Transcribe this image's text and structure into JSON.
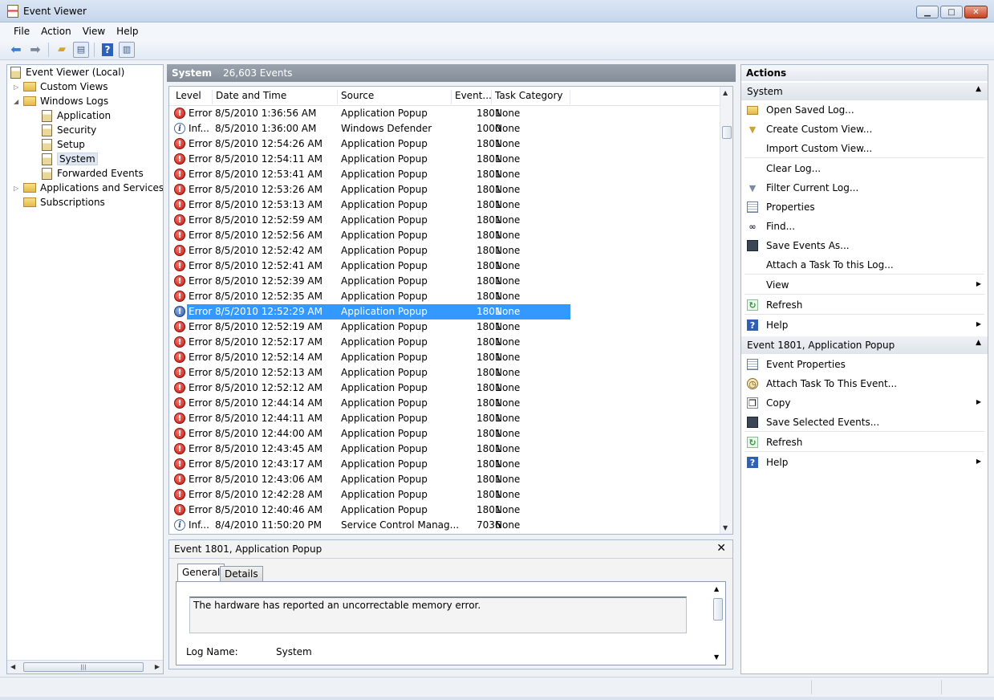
{
  "window": {
    "title": "Event Viewer"
  },
  "menu": [
    "File",
    "Action",
    "View",
    "Help"
  ],
  "toolbar": [
    "back-arrow-icon",
    "forward-arrow-icon",
    "up-folder-icon",
    "show-hide-tree-icon",
    "help-icon",
    "show-hide-action-pane-icon"
  ],
  "tree": {
    "root": "Event Viewer (Local)",
    "custom_views": "Custom Views",
    "windows_logs": "Windows Logs",
    "logs": [
      "Application",
      "Security",
      "Setup",
      "System",
      "Forwarded Events"
    ],
    "selected_log": "System",
    "apps_services": "Applications and Services Lo",
    "subscriptions": "Subscriptions"
  },
  "center": {
    "log_name": "System",
    "event_count": "26,603 Events",
    "columns": [
      "Level",
      "Date and Time",
      "Source",
      "Event...",
      "Task Category"
    ],
    "rows": [
      {
        "level": "Error",
        "kind": "error",
        "date": "8/5/2010 1:36:56 AM",
        "source": "Application Popup",
        "event": "1801",
        "task": "None"
      },
      {
        "level": "Inf...",
        "kind": "info",
        "date": "8/5/2010 1:36:00 AM",
        "source": "Windows Defender",
        "event": "1000",
        "task": "None"
      },
      {
        "level": "Error",
        "kind": "error",
        "date": "8/5/2010 12:54:26 AM",
        "source": "Application Popup",
        "event": "1801",
        "task": "None"
      },
      {
        "level": "Error",
        "kind": "error",
        "date": "8/5/2010 12:54:11 AM",
        "source": "Application Popup",
        "event": "1801",
        "task": "None"
      },
      {
        "level": "Error",
        "kind": "error",
        "date": "8/5/2010 12:53:41 AM",
        "source": "Application Popup",
        "event": "1801",
        "task": "None"
      },
      {
        "level": "Error",
        "kind": "error",
        "date": "8/5/2010 12:53:26 AM",
        "source": "Application Popup",
        "event": "1801",
        "task": "None"
      },
      {
        "level": "Error",
        "kind": "error",
        "date": "8/5/2010 12:53:13 AM",
        "source": "Application Popup",
        "event": "1801",
        "task": "None"
      },
      {
        "level": "Error",
        "kind": "error",
        "date": "8/5/2010 12:52:59 AM",
        "source": "Application Popup",
        "event": "1801",
        "task": "None"
      },
      {
        "level": "Error",
        "kind": "error",
        "date": "8/5/2010 12:52:56 AM",
        "source": "Application Popup",
        "event": "1801",
        "task": "None"
      },
      {
        "level": "Error",
        "kind": "error",
        "date": "8/5/2010 12:52:42 AM",
        "source": "Application Popup",
        "event": "1801",
        "task": "None"
      },
      {
        "level": "Error",
        "kind": "error",
        "date": "8/5/2010 12:52:41 AM",
        "source": "Application Popup",
        "event": "1801",
        "task": "None"
      },
      {
        "level": "Error",
        "kind": "error",
        "date": "8/5/2010 12:52:39 AM",
        "source": "Application Popup",
        "event": "1801",
        "task": "None"
      },
      {
        "level": "Error",
        "kind": "error",
        "date": "8/5/2010 12:52:35 AM",
        "source": "Application Popup",
        "event": "1801",
        "task": "None"
      },
      {
        "level": "Error",
        "kind": "error",
        "date": "8/5/2010 12:52:29 AM",
        "source": "Application Popup",
        "event": "1801",
        "task": "None",
        "selected": true
      },
      {
        "level": "Error",
        "kind": "error",
        "date": "8/5/2010 12:52:19 AM",
        "source": "Application Popup",
        "event": "1801",
        "task": "None"
      },
      {
        "level": "Error",
        "kind": "error",
        "date": "8/5/2010 12:52:17 AM",
        "source": "Application Popup",
        "event": "1801",
        "task": "None"
      },
      {
        "level": "Error",
        "kind": "error",
        "date": "8/5/2010 12:52:14 AM",
        "source": "Application Popup",
        "event": "1801",
        "task": "None"
      },
      {
        "level": "Error",
        "kind": "error",
        "date": "8/5/2010 12:52:13 AM",
        "source": "Application Popup",
        "event": "1801",
        "task": "None"
      },
      {
        "level": "Error",
        "kind": "error",
        "date": "8/5/2010 12:52:12 AM",
        "source": "Application Popup",
        "event": "1801",
        "task": "None"
      },
      {
        "level": "Error",
        "kind": "error",
        "date": "8/5/2010 12:44:14 AM",
        "source": "Application Popup",
        "event": "1801",
        "task": "None"
      },
      {
        "level": "Error",
        "kind": "error",
        "date": "8/5/2010 12:44:11 AM",
        "source": "Application Popup",
        "event": "1801",
        "task": "None"
      },
      {
        "level": "Error",
        "kind": "error",
        "date": "8/5/2010 12:44:00 AM",
        "source": "Application Popup",
        "event": "1801",
        "task": "None"
      },
      {
        "level": "Error",
        "kind": "error",
        "date": "8/5/2010 12:43:45 AM",
        "source": "Application Popup",
        "event": "1801",
        "task": "None"
      },
      {
        "level": "Error",
        "kind": "error",
        "date": "8/5/2010 12:43:17 AM",
        "source": "Application Popup",
        "event": "1801",
        "task": "None"
      },
      {
        "level": "Error",
        "kind": "error",
        "date": "8/5/2010 12:43:06 AM",
        "source": "Application Popup",
        "event": "1801",
        "task": "None"
      },
      {
        "level": "Error",
        "kind": "error",
        "date": "8/5/2010 12:42:28 AM",
        "source": "Application Popup",
        "event": "1801",
        "task": "None"
      },
      {
        "level": "Error",
        "kind": "error",
        "date": "8/5/2010 12:40:46 AM",
        "source": "Application Popup",
        "event": "1801",
        "task": "None"
      },
      {
        "level": "Inf...",
        "kind": "info",
        "date": "8/4/2010 11:50:20 PM",
        "source": "Service Control Manag...",
        "event": "7036",
        "task": "None"
      }
    ]
  },
  "detail": {
    "title": "Event 1801, Application Popup",
    "tabs": [
      "General",
      "Details"
    ],
    "message": "The hardware has reported an uncorrectable memory error.",
    "log_name_label": "Log Name:",
    "log_name_value": "System"
  },
  "actions": {
    "title": "Actions",
    "system_section": "System",
    "system_items": [
      {
        "label": "Open Saved Log...",
        "icon": "open-folder-icon"
      },
      {
        "label": "Create Custom View...",
        "icon": "filter-icon"
      },
      {
        "label": "Import Custom View...",
        "icon": ""
      },
      {
        "label": "Clear Log...",
        "icon": ""
      },
      {
        "label": "Filter Current Log...",
        "icon": "filter-icon"
      },
      {
        "label": "Properties",
        "icon": "properties-icon"
      },
      {
        "label": "Find...",
        "icon": "binoculars-icon"
      },
      {
        "label": "Save Events As...",
        "icon": "save-icon"
      },
      {
        "label": "Attach a Task To this Log...",
        "icon": ""
      },
      {
        "label": "View",
        "icon": "",
        "submenu": true
      },
      {
        "label": "Refresh",
        "icon": "refresh-icon"
      },
      {
        "label": "Help",
        "icon": "help-icon",
        "submenu": true
      }
    ],
    "event_section": "Event 1801, Application Popup",
    "event_items": [
      {
        "label": "Event Properties",
        "icon": "properties-icon"
      },
      {
        "label": "Attach Task To This Event...",
        "icon": "task-icon"
      },
      {
        "label": "Copy",
        "icon": "copy-icon",
        "submenu": true
      },
      {
        "label": "Save Selected Events...",
        "icon": "save-icon"
      },
      {
        "label": "Refresh",
        "icon": "refresh-icon"
      },
      {
        "label": "Help",
        "icon": "help-icon",
        "submenu": true
      }
    ]
  }
}
